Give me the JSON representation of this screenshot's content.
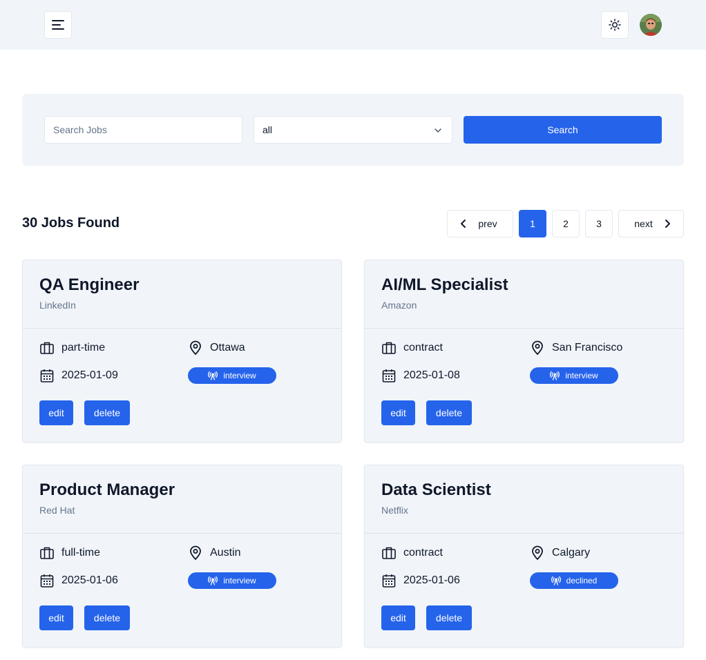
{
  "header": {
    "menu_icon": "hamburger-icon",
    "theme_icon": "sun-icon",
    "avatar_icon": "user-avatar"
  },
  "search": {
    "placeholder": "Search Jobs",
    "value": "",
    "status_selected": "all",
    "button_label": "Search"
  },
  "results": {
    "count_label": "30 Jobs Found"
  },
  "pagination": {
    "prev_label": "prev",
    "next_label": "next",
    "pages": [
      "1",
      "2",
      "3"
    ],
    "active_page": "1"
  },
  "colors": {
    "primary": "#2563eb",
    "panel": "#f1f5f9",
    "muted": "#64748b"
  },
  "jobs": [
    {
      "position": "QA Engineer",
      "company": "LinkedIn",
      "type": "part-time",
      "location": "Ottawa",
      "date": "2025-01-09",
      "status": "interview",
      "edit_label": "edit",
      "delete_label": "delete"
    },
    {
      "position": "AI/ML Specialist",
      "company": "Amazon",
      "type": "contract",
      "location": "San Francisco",
      "date": "2025-01-08",
      "status": "interview",
      "edit_label": "edit",
      "delete_label": "delete"
    },
    {
      "position": "Product Manager",
      "company": "Red Hat",
      "type": "full-time",
      "location": "Austin",
      "date": "2025-01-06",
      "status": "interview",
      "edit_label": "edit",
      "delete_label": "delete"
    },
    {
      "position": "Data Scientist",
      "company": "Netflix",
      "type": "contract",
      "location": "Calgary",
      "date": "2025-01-06",
      "status": "declined",
      "edit_label": "edit",
      "delete_label": "delete"
    }
  ]
}
